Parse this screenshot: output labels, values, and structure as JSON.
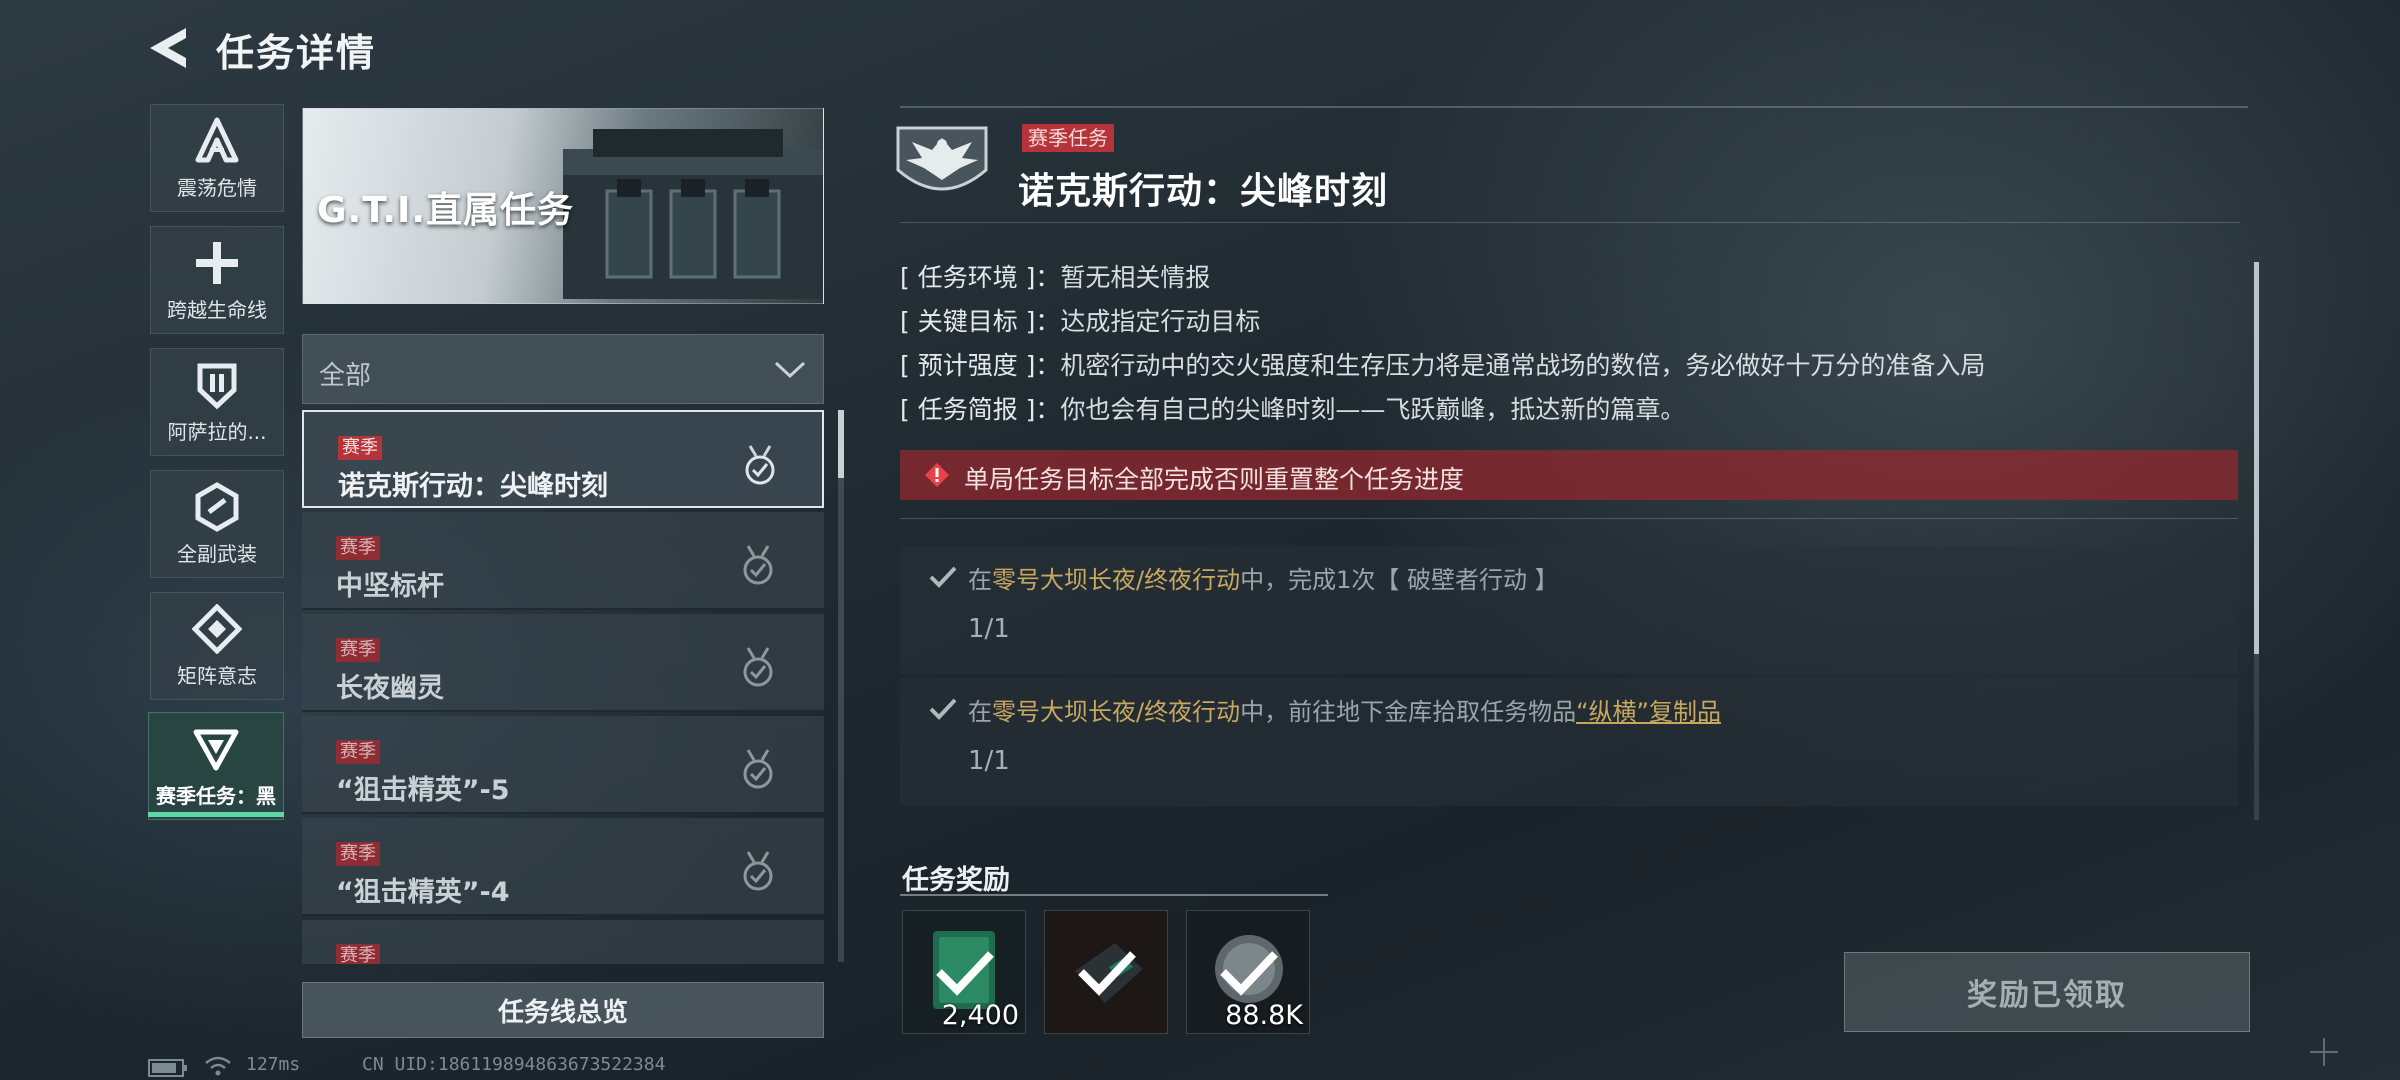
{
  "header": {
    "title": "任务详情"
  },
  "categories": [
    {
      "label": "震荡危情",
      "icon": "shock-crisis-icon"
    },
    {
      "label": "跨越生命线",
      "icon": "cross-lifeline-icon"
    },
    {
      "label": "阿萨拉的...",
      "icon": "shield-icon"
    },
    {
      "label": "全副武装",
      "icon": "hex-armor-icon"
    },
    {
      "label": "矩阵意志",
      "icon": "diamond-matrix-icon"
    },
    {
      "label": "赛季任务：黑",
      "icon": "triangle-season-icon",
      "active": true
    }
  ],
  "banner": {
    "title": "G.T.I.直属任务"
  },
  "filter": {
    "value": "全部"
  },
  "missions": [
    {
      "tag": "赛季",
      "name": "诺克斯行动：尖峰时刻",
      "selected": true
    },
    {
      "tag": "赛季",
      "name": "中坚标杆"
    },
    {
      "tag": "赛季",
      "name": "长夜幽灵"
    },
    {
      "tag": "赛季",
      "name": "“狙击精英”-5"
    },
    {
      "tag": "赛季",
      "name": "“狙击精英”-4"
    },
    {
      "tag": "赛季",
      "name": ""
    }
  ],
  "overview_button": "任务线总览",
  "status_bar": {
    "ping": "127ms",
    "uid": "CN UID:18611989486367352238​4"
  },
  "detail": {
    "tag": "赛季任务",
    "title": "诺克斯行动：尖峰时刻",
    "info": [
      {
        "label": "[ 任务环境 ]：",
        "value": "暂无相关情报"
      },
      {
        "label": "[ 关键目标 ]：",
        "value": "达成指定行动目标"
      },
      {
        "label": "[ 预计强度 ]：",
        "value": "机密行动中的交火强度和生存压力将是通常战场的数倍，务必做好十万分的准备入局"
      },
      {
        "label": "[ 任务简报 ]：",
        "value": "你也会有自己的尖峰时刻——飞跃巅峰，抵达新的篇章。"
      }
    ],
    "warning": "单局任务目标全部完成否则重置整个任务进度",
    "objectives": [
      {
        "pre": "在",
        "map": "零号大坝长夜/终夜行动",
        "mid": "中，完成1次【 破壁者行动 】",
        "item": "",
        "progress": "1/1"
      },
      {
        "pre": "在",
        "map": "零号大坝长夜/终夜行动",
        "mid": "中，前往地下金库拾取任务物品",
        "item": "“纵横”复制品",
        "progress": "1/1"
      }
    ]
  },
  "rewards": {
    "title": "任务奖励",
    "items": [
      {
        "count": "2,400",
        "icon": "currency-reward-icon"
      },
      {
        "count": "",
        "icon": "dark-item-reward-icon"
      },
      {
        "count": "88.8K",
        "icon": "coin-reward-icon"
      }
    ]
  },
  "claim_button": "奖励已领取",
  "colors": {
    "accent_green": "#5fd6a6",
    "season_red": "#b5333a",
    "highlight_gold": "#c8a860"
  }
}
